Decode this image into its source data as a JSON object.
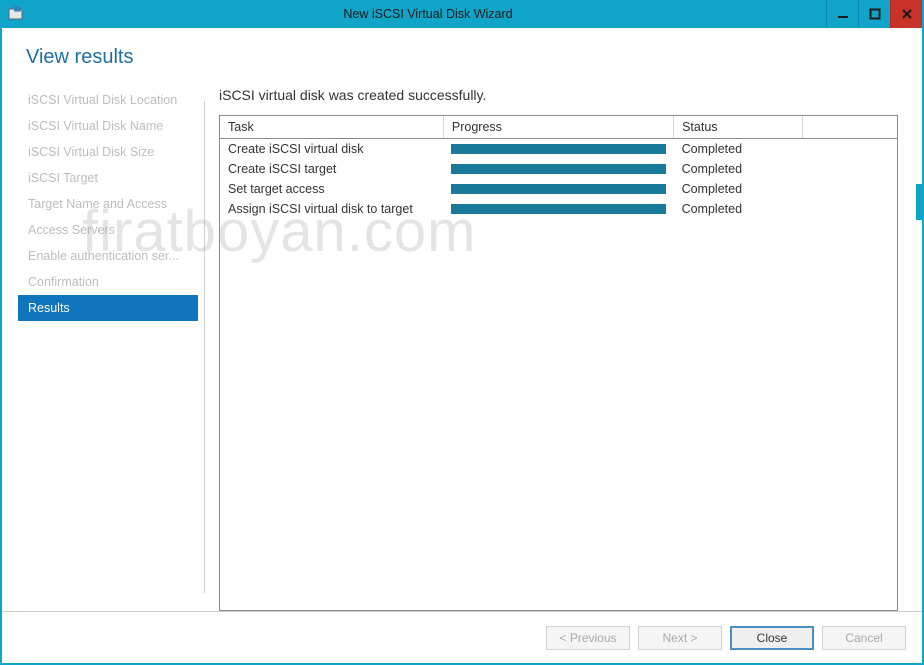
{
  "window": {
    "title": "New iSCSI Virtual Disk Wizard"
  },
  "page": {
    "title": "View results"
  },
  "steps": [
    {
      "label": "iSCSI Virtual Disk Location",
      "active": false
    },
    {
      "label": "iSCSI Virtual Disk Name",
      "active": false
    },
    {
      "label": "iSCSI Virtual Disk Size",
      "active": false
    },
    {
      "label": "iSCSI Target",
      "active": false
    },
    {
      "label": "Target Name and Access",
      "active": false
    },
    {
      "label": "Access Servers",
      "active": false
    },
    {
      "label": "Enable authentication ser...",
      "active": false
    },
    {
      "label": "Confirmation",
      "active": false
    },
    {
      "label": "Results",
      "active": true
    }
  ],
  "results": {
    "message": "iSCSI virtual disk was created successfully.",
    "columns": {
      "task": "Task",
      "progress": "Progress",
      "status": "Status"
    },
    "tasks": [
      {
        "name": "Create iSCSI virtual disk",
        "status": "Completed",
        "progress": 100
      },
      {
        "name": "Create iSCSI target",
        "status": "Completed",
        "progress": 100
      },
      {
        "name": "Set target access",
        "status": "Completed",
        "progress": 100
      },
      {
        "name": "Assign iSCSI virtual disk to target",
        "status": "Completed",
        "progress": 100
      }
    ]
  },
  "buttons": {
    "previous": "< Previous",
    "next": "Next >",
    "close": "Close",
    "cancel": "Cancel"
  },
  "button_state": {
    "previous_enabled": false,
    "next_enabled": false,
    "close_enabled": true,
    "cancel_enabled": false
  },
  "watermark": "firatboyan.com",
  "colors": {
    "accent": "#0fa4c8",
    "link": "#1e6fa0",
    "step_active_bg": "#0f75bc",
    "progress_fill": "#1a7a99",
    "close_red": "#c83228"
  }
}
